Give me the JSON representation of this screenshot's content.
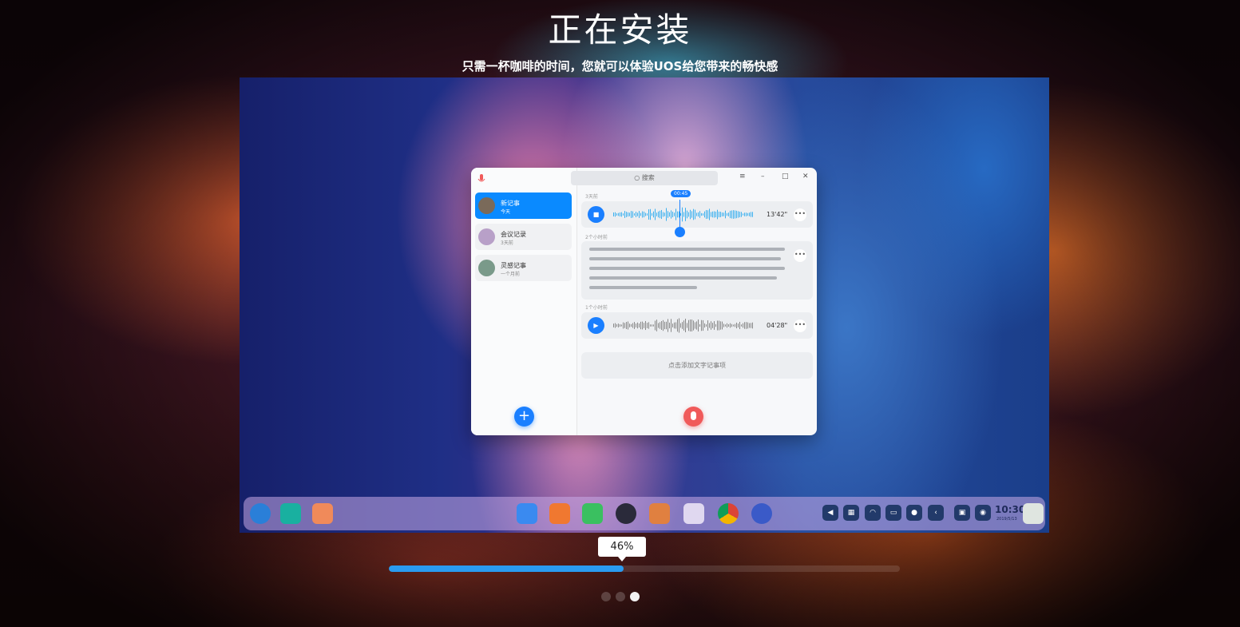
{
  "title": "正在安装",
  "subtitle": "只需一杯咖啡的时间，您就可以体验UOS给您带来的畅快感",
  "slide": {
    "app": {
      "search_placeholder": "搜索",
      "notes": [
        {
          "title": "新记事",
          "date": "今天"
        },
        {
          "title": "会议记录",
          "date": "3天前"
        },
        {
          "title": "灵感记事",
          "date": "一个月前"
        }
      ],
      "recordings": [
        {
          "label": "3天前",
          "duration": "13'42\"",
          "marker": "00:45"
        },
        {
          "label": "1个小时前",
          "duration": "04'28\""
        }
      ],
      "text_label": "2个小时前",
      "add_text": "点击添加文字记事项"
    },
    "dock": {
      "clock": "10:30",
      "date": "2019/5/13"
    }
  },
  "progress": {
    "percent_label": "46%",
    "value": 0.46
  },
  "pager": {
    "count": 3,
    "active": 3
  },
  "colors": {
    "accent": "#2a9bf0",
    "record": "#f05a5a"
  }
}
